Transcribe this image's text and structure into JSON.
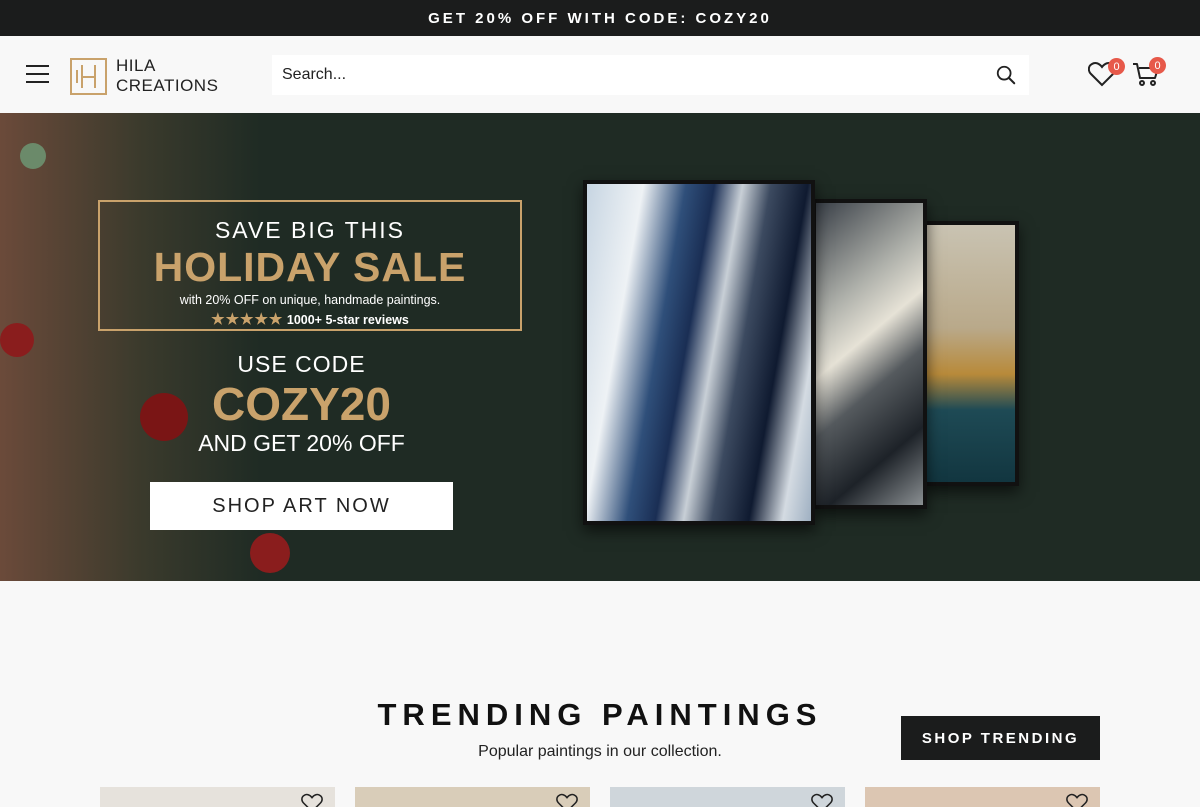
{
  "announcement": {
    "text": "GET 20% OFF WITH CODE: COZY20"
  },
  "header": {
    "logo": {
      "line1": "HILA",
      "line2": "CREATIONS"
    },
    "search": {
      "placeholder": "Search..."
    },
    "wishlist_count": "0",
    "cart_count": "0"
  },
  "hero": {
    "promo_line1": "SAVE BIG THIS",
    "promo_line2": "HOLIDAY SALE",
    "promo_line3": "with 20% OFF on unique, handmade paintings.",
    "stars": "★★★★★",
    "reviews": "1000+ 5-star reviews",
    "code_intro": "USE CODE",
    "code": "COZY20",
    "code_outro": "AND GET 20% OFF",
    "cta_label": "SHOP ART NOW"
  },
  "trending": {
    "title": "TRENDING PAINTINGS",
    "subtitle": "Popular paintings in our collection.",
    "button_label": "SHOP TRENDING",
    "cards": [
      {
        "bg": "#e6e2dc"
      },
      {
        "bg": "#d9cdb9"
      },
      {
        "bg": "#cfd6db"
      },
      {
        "bg": "#dcc6b2"
      }
    ]
  },
  "colors": {
    "accent_gold": "#c9a26b",
    "badge_red": "#e7594a",
    "dark": "#1b1c1c",
    "hero_bg": "#1f2b24"
  }
}
